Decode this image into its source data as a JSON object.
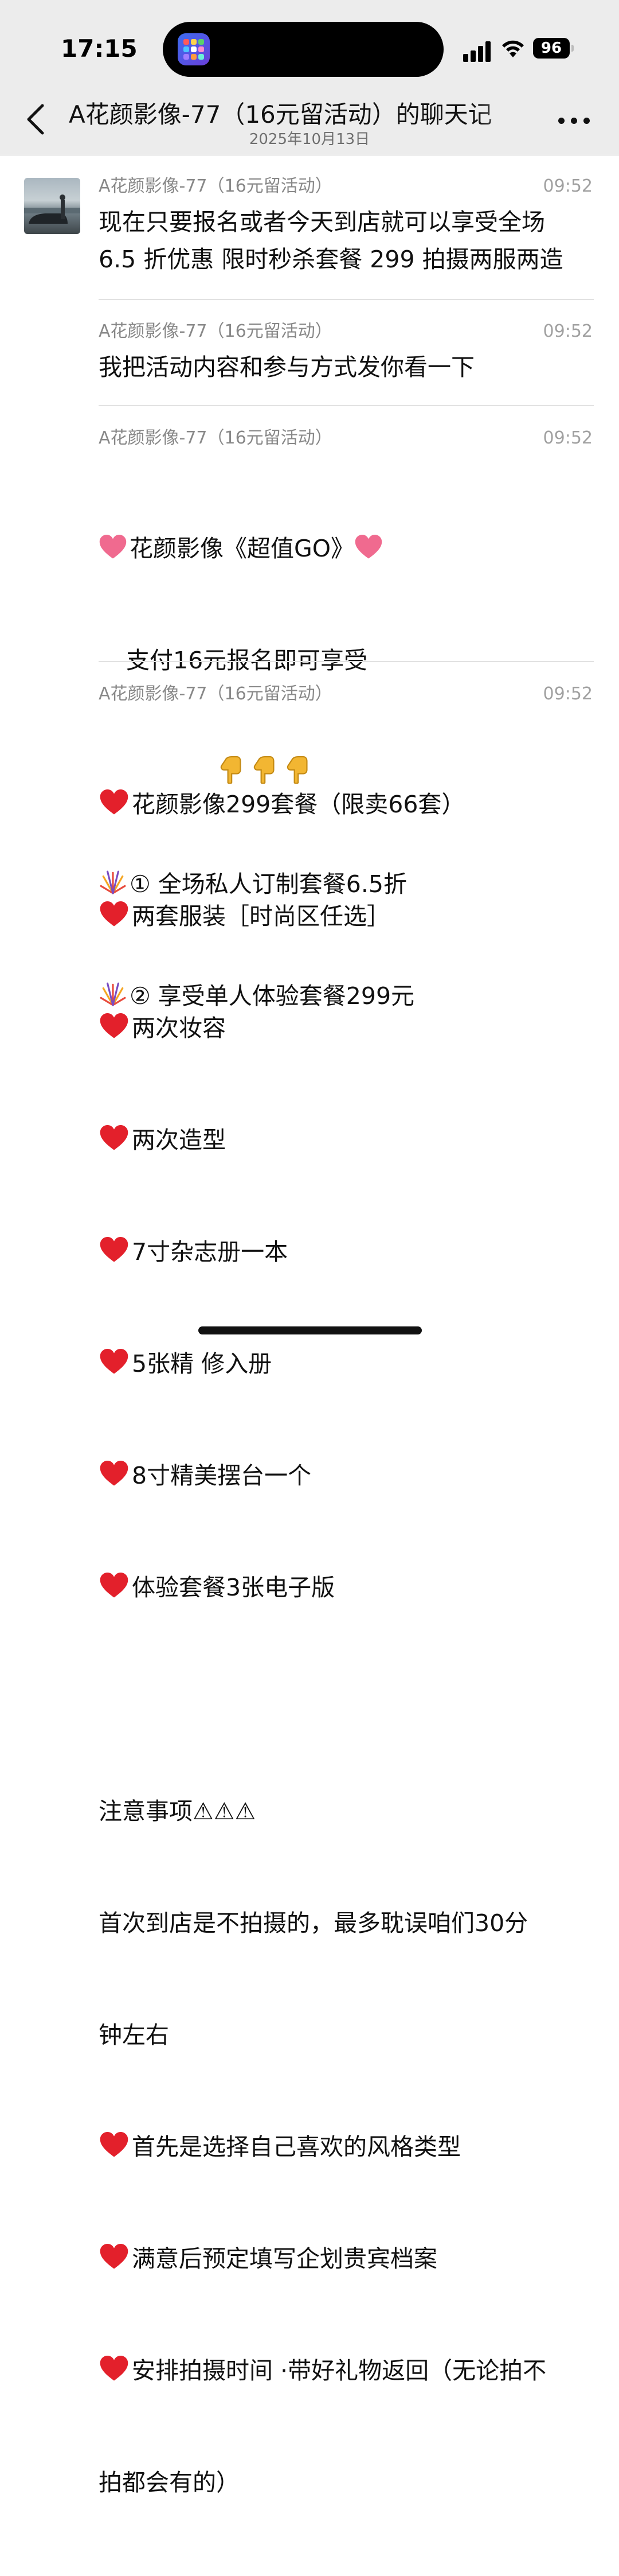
{
  "status_bar": {
    "time": "17:15",
    "battery": "96"
  },
  "header": {
    "title": "A花颜影像-77（16元留活动）的聊天记",
    "date": "2025年10月13日"
  },
  "messages": [
    {
      "sender": "A花颜影像-77（16元留活动）",
      "time": "09:52",
      "lines": [
        "现在只要报名或者今天到店就可以享受全场",
        "6.5 折优惠 限时秒杀套餐 299 拍摄两服两造"
      ]
    },
    {
      "sender": "A花颜影像-77（16元留活动）",
      "time": "09:52",
      "lines": [
        "我把活动内容和参与方式发你看一下"
      ]
    },
    {
      "sender": "A花颜影像-77（16元留活动）",
      "time": "09:52",
      "lines": [
        "花颜影像《超值GO》",
        "支付16元报名即可享受",
        "",
        "① 全场私人订制套餐6.5折",
        "② 享受单人体验套餐299元"
      ]
    },
    {
      "sender": "A花颜影像-77（16元留活动）",
      "time": "09:52",
      "lines": [
        "花颜影像299套餐（限卖66套）",
        "两套服装［时尚区任选］",
        "两次妆容",
        "两次造型",
        "7寸杂志册一本",
        "5张精 修入册",
        "8寸精美摆台一个",
        "体验套餐3张电子版",
        "",
        "注意事项⚠⚠⚠",
        "首次到店是不拍摄的，最多耽误咱们30分",
        "钟左右",
        "首先是选择自己喜欢的风格类型",
        "满意后预定填写企划贵宾档案",
        "安排拍摄时间 ·带好礼物返回（无论拍不",
        "拍都会有的）"
      ]
    }
  ],
  "icons": {
    "heart_pink": "pink-heart-icon",
    "heart_red": "red-heart-icon",
    "point_down": "point-down-icon",
    "firework": "fireworks-icon"
  },
  "colors": {
    "bar": "#ececec",
    "red_heart": "#e3202b",
    "pink_heart": "#f06a8f",
    "hand": "#f2b632"
  }
}
